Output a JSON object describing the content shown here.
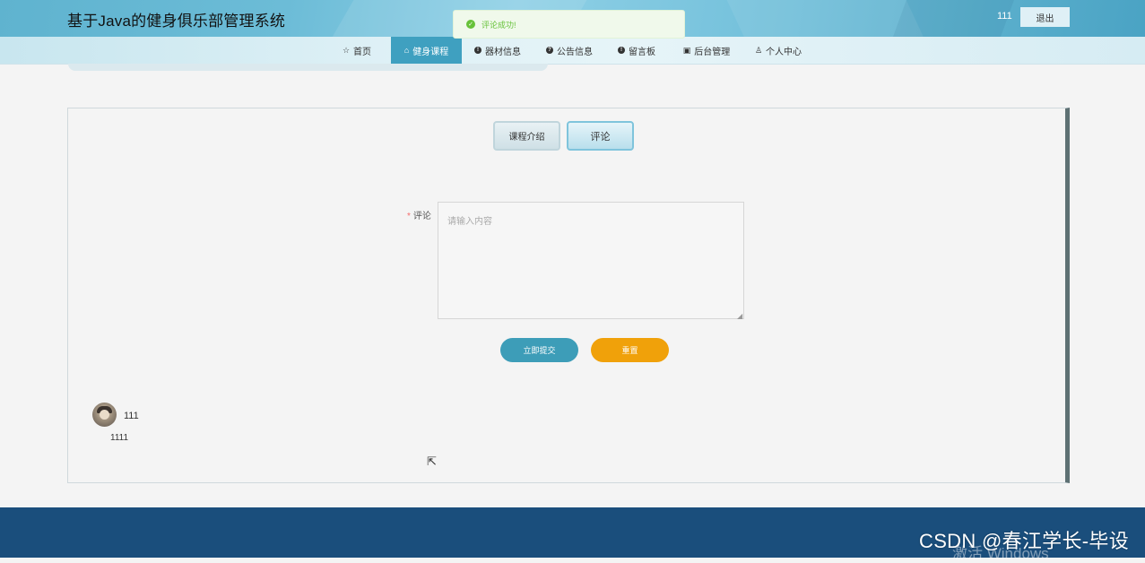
{
  "header": {
    "title": "基于Java的健身俱乐部管理系统",
    "username": "111",
    "logout_label": "退出"
  },
  "toast": {
    "message": "评论成功!",
    "icon": "check-circle-icon",
    "color": "#67c23a"
  },
  "nav": {
    "items": [
      {
        "label": "首页",
        "icon": "star-icon",
        "active": false
      },
      {
        "label": "健身课程",
        "icon": "bag-icon",
        "active": true
      },
      {
        "label": "器材信息",
        "icon": "info-icon",
        "active": false
      },
      {
        "label": "公告信息",
        "icon": "question-icon",
        "active": false
      },
      {
        "label": "留言板",
        "icon": "info-icon",
        "active": false
      },
      {
        "label": "后台管理",
        "icon": "briefcase-icon",
        "active": false
      },
      {
        "label": "个人中心",
        "icon": "user-icon",
        "active": false
      }
    ],
    "active_color": "#3fa0c0"
  },
  "tabs": [
    {
      "label": "课程介绍",
      "active": false
    },
    {
      "label": "评论",
      "active": true
    }
  ],
  "form": {
    "comment_label": "评论",
    "required_mark": "*",
    "comment_placeholder": "请输入内容",
    "comment_value": "",
    "submit_label": "立即提交",
    "reset_label": "重置",
    "submit_color": "#3d9db8",
    "reset_color": "#f0a10a"
  },
  "comments": [
    {
      "user": "111",
      "text": "1111"
    }
  ],
  "footer": {
    "watermark": "CSDN @春江学长-毕设",
    "activate_text": "激活 Windows",
    "color": "#1a4e7c"
  }
}
